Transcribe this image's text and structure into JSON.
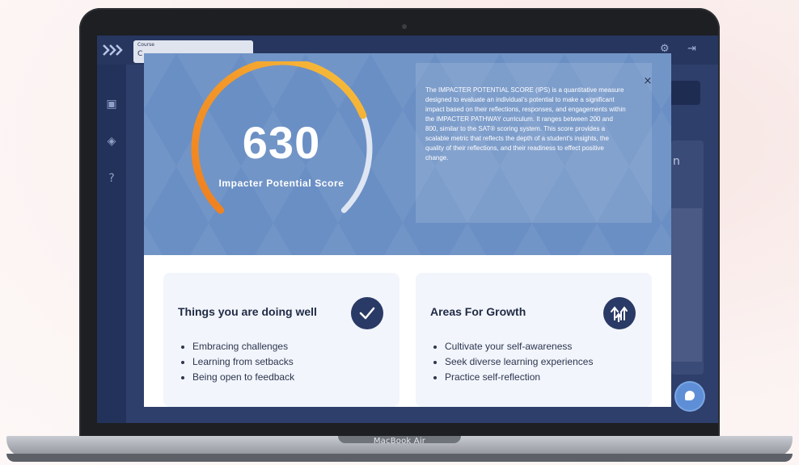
{
  "device": {
    "label": "MacBook Air"
  },
  "app": {
    "course": {
      "label": "Course",
      "value": "C"
    },
    "right_panel_letter": "n"
  },
  "modal": {
    "score": "630",
    "score_label": "Impacter Potential Score",
    "gauge_progress": 0.75,
    "description": "The IMPACTER POTENTIAL SCORE (IPS) is a quantitative measure designed to evaluate an individual's potential to make a significant impact based on their reflections, responses, and engagements within the IMPACTER PATHWAY curriculum. It ranges between 200 and 800, similar to the SAT® scoring system. This score provides a scalable metric that reflects the depth of a student's insights, the quality of their reflections, and their readiness to effect positive change.",
    "close_label": "×",
    "strengths": {
      "title": "Things you are doing well",
      "icon": "checkmark-icon",
      "items": [
        "Embracing challenges",
        "Learning from setbacks",
        "Being open to feedback"
      ]
    },
    "growth": {
      "title": "Areas For Growth",
      "icon": "growth-arrows-icon",
      "items": [
        "Cultivate your self-awareness",
        "Seek diverse learning experiences",
        "Practice self-reflection"
      ]
    }
  },
  "colors": {
    "modal_header": "#6a8fc4",
    "gauge_orange": "#f08a24",
    "gauge_yellow": "#f5b93a",
    "gauge_track": "#dfe6f3",
    "badge": "#2a3a66"
  }
}
